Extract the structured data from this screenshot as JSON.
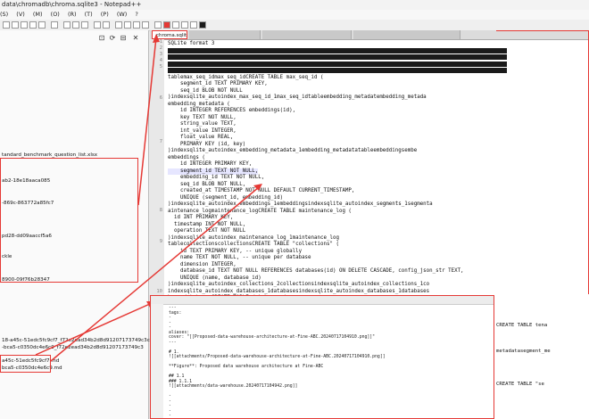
{
  "window": {
    "title": "data\\chromadb\\chroma.sqlite3 - Notepad++"
  },
  "menu": [
    "(S)",
    "(V)",
    "(M)",
    "(O)",
    "(R)",
    "(T)",
    "(P)",
    "(W)",
    "?"
  ],
  "left_panel": {
    "items": [
      "tandard_benchmark_question_list.xlsx",
      "ab2-18e18aaca085",
      "-869c-863772a85fc7",
      "pd28-dd09aaccf5a6",
      "ckle",
      "8900-09f76b28347",
      "18-a45c-51edc5fc9cf7_f72e2ead34b2d8d91207173749c3c",
      "-bca5-c0350dc4e6c9_f72e2ead34b2d8d91207173749c3",
      "a45c-51edc5fc9cf7.md",
      "bca5-c0350dc4e6c9.md"
    ]
  },
  "editor": {
    "active_tab": "chroma.sqlite3",
    "other_tabs": [
      "",
      "",
      ""
    ],
    "line_numbers": [
      "1",
      "2",
      "3",
      "4",
      "5",
      "6",
      "7",
      "8",
      "9",
      "10"
    ],
    "lines": [
      "SQLite format 3",
      "",
      "",
      "",
      "",
      "tablemax_seq_idmax_seq_idCREATE TABLE max_seq_id (",
      "    segment_id TEXT PRIMARY KEY,",
      "    seq_id BLOB NOT NULL",
      ")indexsqlite_autoindex_max_seq_id_1max_seq_idtableembedding_metadatembedding_metada",
      "embedding_metadata (",
      "    id INTEGER REFERENCES embeddings(id),",
      "    key TEXT NOT NULL,",
      "    string_value TEXT,",
      "    int_value INTEGER,",
      "    float_value REAL,",
      "    PRIMARY KEY (id, key)",
      ")indexsqlite_autoindex_embedding_metadata_1embedding_metadatatableembeddingsembe",
      "embeddings (",
      "    id INTEGER PRIMARY KEY,",
      "    segment_id TEXT NOT NULL,",
      "    embedding_id TEXT NOT NULL,",
      "    seq_id BLOB NOT NULL,",
      "    created_at TIMESTAMP NOT NULL DEFAULT CURRENT_TIMESTAMP,",
      "    UNIQUE (segment_id, embedding_id)",
      ")indexsqlite_autoindex_embeddings_1embeddingsindexsqlite_autoindex_segments_1segmenta",
      "aintenance_logmaintenance_logCREATE TABLE maintenance_log (",
      "  id INT PRIMARY KEY,",
      "  timestamp INT NOT NULL,",
      "  operation TEXT NOT NULL",
      ")indexsqlite_autoindex_maintenance_log_1maintenance_log",
      "tablecollectionscollectionsCREATE TABLE \"collections\" (",
      "    id TEXT PRIMARY KEY, -- unique globally",
      "    name TEXT NOT NULL, -- unique per database",
      "    dimension INTEGER,",
      "    database_id TEXT NOT NULL REFERENCES databases(id) ON DELETE CASCADE, config_json_str TEXT,",
      "    UNIQUE (name, database_id)",
      ")indexsqlite_autoindex_collections_2collectionsindexsqlite_autoindex_collections_1co",
      "indexsqlite_autoindex_databases_1databasesindexsqlite_autoindex_databases_1databases",
      "basesdatabasesCREATE TABLE databases ("
    ]
  },
  "popup": {
    "lines": [
      "---",
      "tags:",
      "  - ",
      "  - ",
      "  - ",
      "aliases:",
      "cover: \"[[Proposed-data-warehouse-architecture-at-Fine-ABC.20240717104910.png]]\"",
      "---",
      "",
      "# 1. ",
      "![[attachments/Proposed-data-warehouse-architecture-at-Fine-ABC.20240717104910.png]]",
      "",
      "**Figure**: Proposed data warehouse architecture at Fine-ABC",
      "",
      "## 1.1 ",
      "### 1.1.1 ",
      "![[attachments/data-warehouse.20240717104942.png]]",
      "",
      "- ",
      "- ",
      "- ",
      "- ",
      "- "
    ]
  },
  "right_fragments": [
    "CREATE TABLE tena",
    "metadatasegment_me",
    "CREATE TABLE \"se"
  ],
  "colors": {
    "annotation": "#e53935",
    "selection": "#1a1a1a"
  }
}
